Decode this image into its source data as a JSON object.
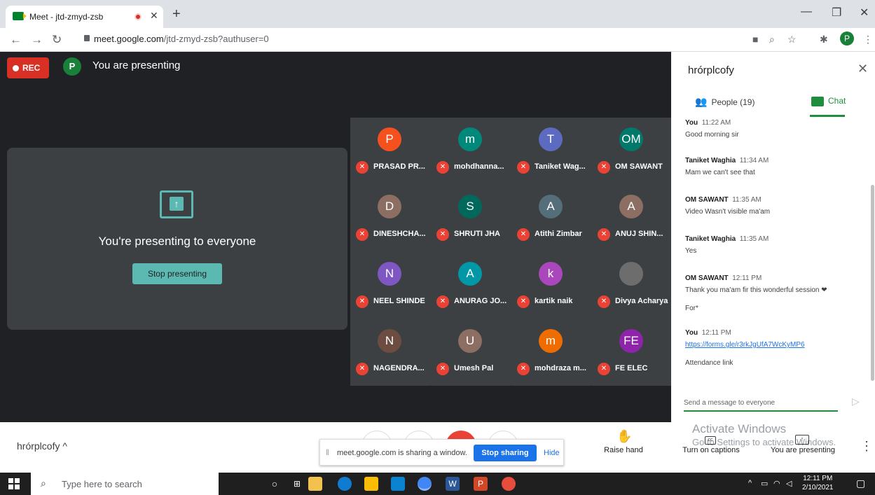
{
  "browser": {
    "tab_title": "Meet - jtd-zmyd-zsb",
    "url_host": "meet.google.com",
    "url_path": "/jtd-zmyd-zsb?authuser=0",
    "profile_initial": "P"
  },
  "stage": {
    "rec_label": "REC",
    "presenter_initial": "P",
    "presenter_label": "You are presenting",
    "present_text": "You're presenting to everyone",
    "stop_presenting": "Stop presenting"
  },
  "participants": [
    {
      "initial": "P",
      "name": "PRASAD PR...",
      "color": "#f4511e"
    },
    {
      "initial": "m",
      "name": "mohdhanna...",
      "color": "#00897b"
    },
    {
      "initial": "T",
      "name": "Taniket Wag...",
      "color": "#5c6bc0"
    },
    {
      "initial": "OM",
      "name": "OM SAWANT",
      "color": "#00796b"
    },
    {
      "initial": "D",
      "name": "DINESHCHA...",
      "color": "#8d6e63"
    },
    {
      "initial": "S",
      "name": "SHRUTI JHA",
      "color": "#00695c"
    },
    {
      "initial": "A",
      "name": "Atithi Zimbar",
      "color": "#546e7a"
    },
    {
      "initial": "A",
      "name": "ANUJ SHIN...",
      "color": "#8d6e63"
    },
    {
      "initial": "N",
      "name": "NEEL SHINDE",
      "color": "#7e57c2"
    },
    {
      "initial": "A",
      "name": "ANURAG JO...",
      "color": "#0097a7"
    },
    {
      "initial": "k",
      "name": "kartik naik",
      "color": "#ab47bc"
    },
    {
      "initial": "",
      "name": "Divya Acharya",
      "color": "#6d6d6d"
    },
    {
      "initial": "N",
      "name": "NAGENDRA...",
      "color": "#6d4c41"
    },
    {
      "initial": "U",
      "name": "Umesh Pal",
      "color": "#8d6e63"
    },
    {
      "initial": "m",
      "name": "mohdraza m...",
      "color": "#ef6c00"
    },
    {
      "initial": "FE",
      "name": "FE ELEC",
      "color": "#8e24aa"
    }
  ],
  "panel": {
    "title": "hrórplcofy",
    "people_tab": "People (19)",
    "chat_tab": "Chat",
    "messages": [
      {
        "sender": "You",
        "time": "11:22 AM",
        "text": "Good morning sir"
      },
      {
        "sender": "Taniket Waghia",
        "time": "11:34 AM",
        "text": "Mam we can't see that"
      },
      {
        "sender": "OM SAWANT",
        "time": "11:35 AM",
        "text": "Video Wasn't visible ma'am"
      },
      {
        "sender": "Taniket Waghia",
        "time": "11:35 AM",
        "text": "Yes"
      },
      {
        "sender": "OM SAWANT",
        "time": "12:11 PM",
        "text": "Thank you ma'am fir this wonderful session ❤",
        "text2": "For*"
      },
      {
        "sender": "You",
        "time": "12:11 PM",
        "link": "https://forms.gle/r3rkJgUfA7WcKyMP6",
        "text2": "Attendance link"
      }
    ],
    "send_placeholder": "Send a message to everyone"
  },
  "bottom": {
    "meeting_code": "hrórplcofy ^",
    "share_text": "meet.google.com is sharing a window.",
    "stop_sharing": "Stop sharing",
    "hide": "Hide",
    "raise_hand": "Raise hand",
    "captions": "Turn on captions",
    "you_presenting": "You are presenting",
    "activate_title": "Activate Windows",
    "activate_sub": "Go to Settings to activate Windows."
  },
  "taskbar": {
    "search_placeholder": "Type here to search",
    "time": "12:11 PM",
    "date": "2/10/2021"
  }
}
